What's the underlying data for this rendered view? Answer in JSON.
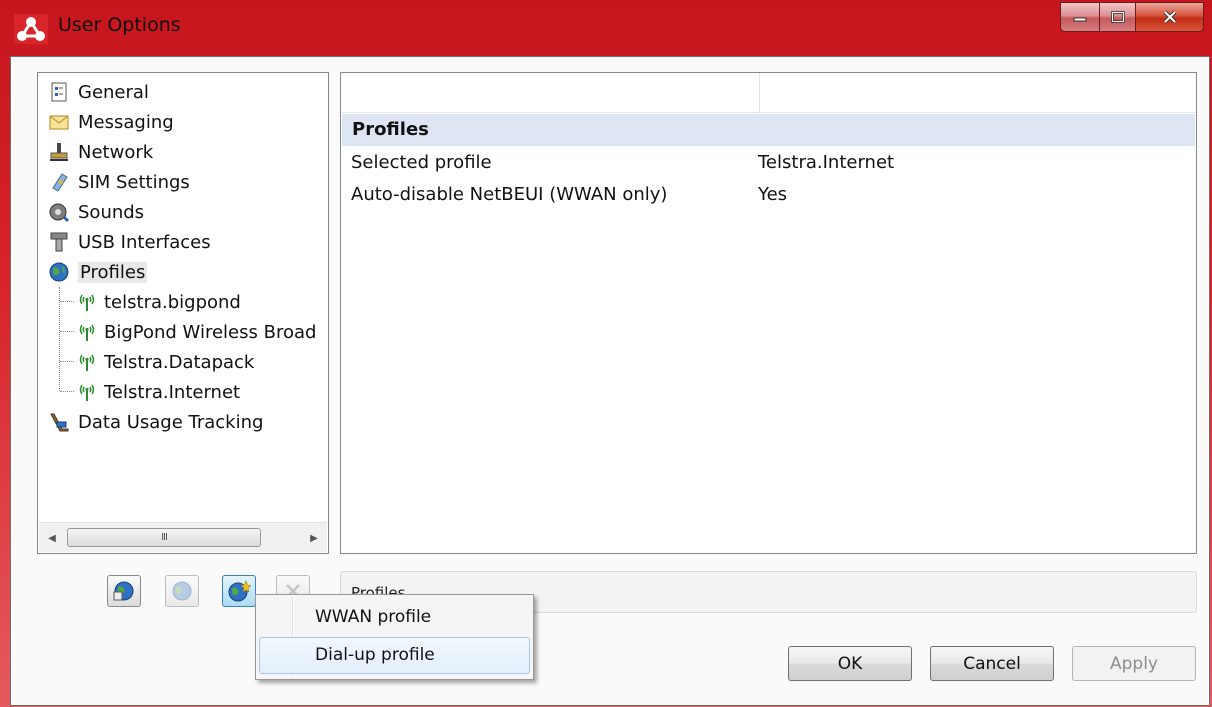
{
  "window": {
    "title": "User Options",
    "icon": "app-logo-icon",
    "controls": {
      "minimize": "minimize-icon",
      "maximize": "maximize-icon",
      "close": "close-icon"
    }
  },
  "tree": {
    "items": [
      {
        "label": "General",
        "icon": "general-icon"
      },
      {
        "label": "Messaging",
        "icon": "envelope-icon"
      },
      {
        "label": "Network",
        "icon": "network-icon"
      },
      {
        "label": "SIM Settings",
        "icon": "sim-card-icon"
      },
      {
        "label": "Sounds",
        "icon": "speaker-icon"
      },
      {
        "label": "USB Interfaces",
        "icon": "usb-icon"
      },
      {
        "label": "Profiles",
        "icon": "globe-icon",
        "selected": true
      },
      {
        "label": "telstra.bigpond",
        "icon": "antenna-icon"
      },
      {
        "label": "BigPond Wireless Broad",
        "icon": "antenna-icon"
      },
      {
        "label": "Telstra.Datapack",
        "icon": "antenna-icon"
      },
      {
        "label": "Telstra.Internet",
        "icon": "antenna-icon"
      },
      {
        "label": "Data Usage Tracking",
        "icon": "usage-tracking-icon"
      }
    ],
    "scrollbar_grip": "III"
  },
  "grid": {
    "category": "Profiles",
    "rows": [
      {
        "key": "Selected profile",
        "value": "Telstra.Internet"
      },
      {
        "key": "Auto-disable NetBEUI (WWAN only)",
        "value": "Yes"
      }
    ]
  },
  "toolbar": {
    "buttons": [
      "connect-profile-icon",
      "edit-profile-icon",
      "add-profile-icon",
      "delete-icon"
    ]
  },
  "status": {
    "text": "Profiles"
  },
  "menu": {
    "items": [
      {
        "label": "WWAN profile"
      },
      {
        "label": "Dial-up profile",
        "hover": true
      }
    ]
  },
  "buttons": {
    "ok": "OK",
    "cancel": "Cancel",
    "apply": "Apply"
  },
  "colors": {
    "titlebar": "#d7232a",
    "selection": "#dfe6f3",
    "hover_border": "#a8c8ea"
  }
}
